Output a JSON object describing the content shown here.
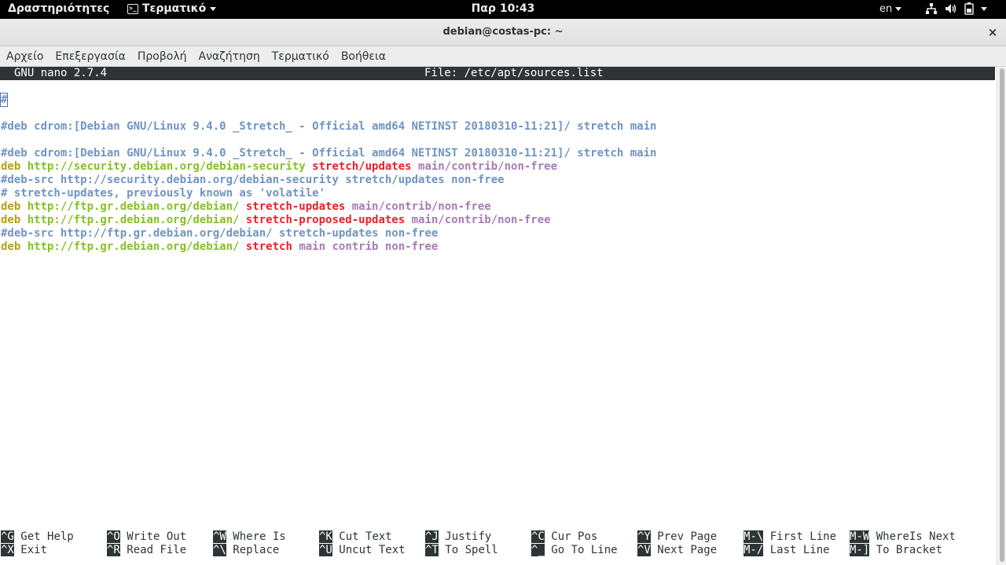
{
  "topbar": {
    "activities": "Δραστηριότητες",
    "app_menu": "Τερματικό",
    "clock": "Παρ 10:43",
    "language": "en",
    "icons": [
      "network-icon",
      "volume-icon",
      "battery-icon",
      "system-menu-caret-icon"
    ]
  },
  "window": {
    "title": "debian@costas-pc: ~",
    "close_glyph": "×"
  },
  "menubar": {
    "items": [
      "Αρχείο",
      "Επεξεργασία",
      "Προβολή",
      "Αναζήτηση",
      "Τερματικό",
      "Βοήθεια"
    ]
  },
  "nano": {
    "version": "GNU nano 2.7.4",
    "file": "File: /etc/apt/sources.list",
    "lines": [
      {
        "cursor": "#"
      },
      {
        "comment": ""
      },
      {
        "comment": "#deb cdrom:[Debian GNU/Linux 9.4.0 _Stretch_ - Official amd64 NETINST 20180310-11:21]/ stretch main"
      },
      {
        "comment": ""
      },
      {
        "comment": "#deb cdrom:[Debian GNU/Linux 9.4.0 _Stretch_ - Official amd64 NETINST 20180310-11:21]/ stretch main"
      },
      {
        "deb": "deb ",
        "url": "http://security.debian.org/debian-security ",
        "suite": "stretch/updates ",
        "comp": "main/contrib/non-free"
      },
      {
        "comment": "#deb-src http://security.debian.org/debian-security stretch/updates non-free"
      },
      {
        "comment": "# stretch-updates, previously known as 'volatile'"
      },
      {
        "deb": "deb ",
        "url": "http://ftp.gr.debian.org/debian/ ",
        "suite": "stretch-updates ",
        "comp": "main/contrib/non-free"
      },
      {
        "deb": "deb ",
        "url": "http://ftp.gr.debian.org/debian/ ",
        "suite": "stretch-proposed-updates ",
        "comp": "main/contrib/non-free"
      },
      {
        "comment": "#deb-src http://ftp.gr.debian.org/debian/ stretch-updates non-free"
      },
      {
        "deb": "deb ",
        "url": "http://ftp.gr.debian.org/debian/ ",
        "suite": "stretch ",
        "comp": "main contrib non-free"
      }
    ],
    "shortcuts_row1": [
      {
        "key": "^G",
        "label": "Get Help"
      },
      {
        "key": "^O",
        "label": "Write Out"
      },
      {
        "key": "^W",
        "label": "Where Is"
      },
      {
        "key": "^K",
        "label": "Cut Text"
      },
      {
        "key": "^J",
        "label": "Justify"
      },
      {
        "key": "^C",
        "label": "Cur Pos"
      },
      {
        "key": "^Y",
        "label": "Prev Page"
      },
      {
        "key": "M-\\",
        "label": "First Line"
      },
      {
        "key": "M-W",
        "label": "WhereIs Next"
      }
    ],
    "shortcuts_row2": [
      {
        "key": "^X",
        "label": "Exit"
      },
      {
        "key": "^R",
        "label": "Read File"
      },
      {
        "key": "^\\",
        "label": "Replace"
      },
      {
        "key": "^U",
        "label": "Uncut Text"
      },
      {
        "key": "^T",
        "label": "To Spell"
      },
      {
        "key": "^_",
        "label": "Go To Line"
      },
      {
        "key": "^V",
        "label": "Next Page"
      },
      {
        "key": "M-/",
        "label": "Last Line"
      },
      {
        "key": "M-]",
        "label": "To Bracket"
      }
    ]
  }
}
